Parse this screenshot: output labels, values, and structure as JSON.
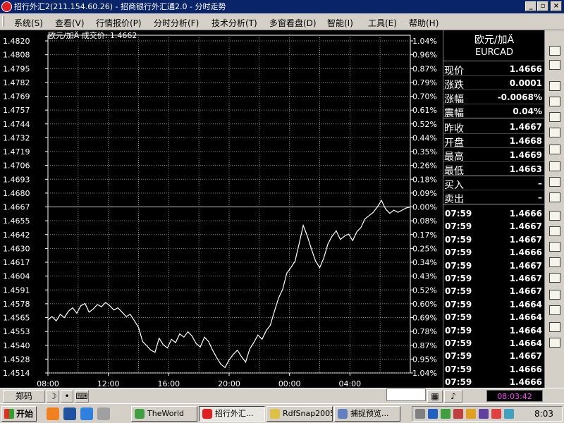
{
  "window": {
    "title": "招行外汇2(211.154.60.26) - 招商银行外汇通2.0 - 分时走势",
    "controls": {
      "minimize": "_",
      "restore": "▫",
      "close": "×"
    }
  },
  "menu": [
    {
      "label": "系统(S)"
    },
    {
      "label": "查看(V)"
    },
    {
      "label": "行情报价(P)"
    },
    {
      "label": "分时分析(F)"
    },
    {
      "label": "技术分析(T)"
    },
    {
      "label": "多窗看盘(D)"
    },
    {
      "label": "智能(I)"
    },
    {
      "label": "工具(E)"
    },
    {
      "label": "帮助(H)"
    }
  ],
  "chart_data": {
    "type": "line",
    "title": "欧元/加Ä 成交价: 1.4662",
    "x_ticks": [
      "08:00",
      "12:00",
      "16:00",
      "20:00",
      "00:00",
      "04:00"
    ],
    "ylim": [
      1.4514,
      1.482
    ],
    "y_ticks": [
      "1.4820",
      "1.4808",
      "1.4795",
      "1.4782",
      "1.4769",
      "1.4757",
      "1.4744",
      "1.4732",
      "1.4719",
      "1.4706",
      "1.4693",
      "1.4680",
      "1.4667",
      "1.4655",
      "1.4642",
      "1.4630",
      "1.4617",
      "1.4604",
      "1.4591",
      "1.4578",
      "1.4565",
      "1.4553",
      "1.4540",
      "1.4528",
      "1.4514"
    ],
    "pct_ticks": [
      "1.04%",
      "0.96%",
      "0.87%",
      "0.79%",
      "0.70%",
      "0.61%",
      "0.52%",
      "0.44%",
      "0.35%",
      "0.26%",
      "0.18%",
      "0.09%",
      "0.00%",
      "0.08%",
      "0.17%",
      "0.25%",
      "0.34%",
      "0.43%",
      "0.52%",
      "0.60%",
      "0.69%",
      "0.78%",
      "0.87%",
      "0.95%",
      "1.04%"
    ],
    "reference_price": 1.4667,
    "grid": true,
    "series": [
      {
        "values": [
          1.4563,
          1.4566,
          1.4562,
          1.4568,
          1.4565,
          1.4571,
          1.4574,
          1.4569,
          1.4576,
          1.4578,
          1.457,
          1.4573,
          1.4577,
          1.4575,
          1.4579,
          1.4576,
          1.4572,
          1.4574,
          1.457,
          1.4566,
          1.4568,
          1.4562,
          1.4556,
          1.4543,
          1.4539,
          1.4535,
          1.4533,
          1.4546,
          1.454,
          1.4537,
          1.4545,
          1.4542,
          1.455,
          1.4547,
          1.4552,
          1.4548,
          1.4541,
          1.4538,
          1.4547,
          1.4543,
          1.4535,
          1.4528,
          1.4522,
          1.4519,
          1.4526,
          1.4531,
          1.4535,
          1.4529,
          1.4524,
          1.4536,
          1.4542,
          1.4549,
          1.4545,
          1.4553,
          1.4558,
          1.4571,
          1.4583,
          1.4591,
          1.4606,
          1.4611,
          1.4617,
          1.4633,
          1.465,
          1.464,
          1.4628,
          1.4617,
          1.4611,
          1.462,
          1.4633,
          1.464,
          1.4645,
          1.4637,
          1.464,
          1.4642,
          1.4636,
          1.4644,
          1.4648,
          1.4656,
          1.4659,
          1.4662,
          1.4667,
          1.4673,
          1.4665,
          1.4661,
          1.4664,
          1.4662,
          1.4664,
          1.4666,
          1.4667
        ]
      }
    ]
  },
  "instrument": {
    "name": "欧元/加Ä",
    "code": "EURCAD"
  },
  "quote": [
    {
      "label": "现价",
      "value": "1.4666"
    },
    {
      "label": "涨跌",
      "value": "0.0001"
    },
    {
      "label": "涨幅",
      "value": "-0.0068%"
    },
    {
      "label": "震幅",
      "value": "0.04%"
    },
    {
      "label": "昨收",
      "value": "1.4667"
    },
    {
      "label": "开盘",
      "value": "1.4668"
    },
    {
      "label": "最高",
      "value": "1.4669"
    },
    {
      "label": "最低",
      "value": "1.4663"
    },
    {
      "label": "买入",
      "value": "–"
    },
    {
      "label": "卖出",
      "value": "–"
    }
  ],
  "ticks": [
    {
      "time": "07:59",
      "price": "1.4666"
    },
    {
      "time": "07:59",
      "price": "1.4667"
    },
    {
      "time": "07:59",
      "price": "1.4667"
    },
    {
      "time": "07:59",
      "price": "1.4666"
    },
    {
      "time": "07:59",
      "price": "1.4667"
    },
    {
      "time": "07:59",
      "price": "1.4667"
    },
    {
      "time": "07:59",
      "price": "1.4667"
    },
    {
      "time": "07:59",
      "price": "1.4664"
    },
    {
      "time": "07:59",
      "price": "1.4664"
    },
    {
      "time": "07:59",
      "price": "1.4664"
    },
    {
      "time": "07:59",
      "price": "1.4664"
    },
    {
      "time": "07:59",
      "price": "1.4667"
    },
    {
      "time": "07:59",
      "price": "1.4666"
    },
    {
      "time": "07:59",
      "price": "1.4666"
    }
  ],
  "bottom": {
    "code_label": "郑码",
    "clock": "08:03:42"
  },
  "taskbar": {
    "start_label": "开始",
    "tasks": [
      {
        "label": "TheWorld"
      },
      {
        "label": "招行外汇..."
      },
      {
        "label": "RdfSnap2005"
      },
      {
        "label": "捕捉预览..."
      }
    ],
    "time": "8:03"
  }
}
